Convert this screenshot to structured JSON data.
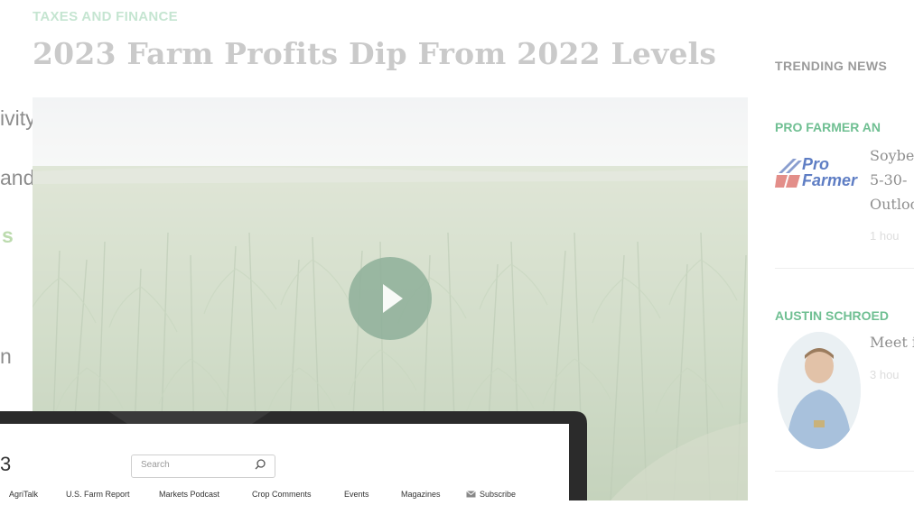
{
  "article": {
    "category": "TAXES AND FINANCE",
    "headline": "2023 Farm Profits Dip From 2022 Levels"
  },
  "background_text": {
    "line1": "ivity.",
    "line2": "and",
    "line3": "s",
    "line4": "n"
  },
  "video": {
    "play_icon": "play-icon"
  },
  "laptop": {
    "logo_fragment": "3",
    "search_placeholder": "Search",
    "nav": [
      "AgriTalk",
      "U.S. Farm Report",
      "Markets Podcast",
      "Crop Comments",
      "Events",
      "Magazines",
      "Subscribe"
    ]
  },
  "sidebar": {
    "title": "TRENDING NEWS",
    "items": [
      {
        "category": "PRO FARMER AN",
        "lines": [
          "Soybe",
          "5-30-",
          "Outloo"
        ],
        "time": "1 hou",
        "logo_line1": "Pro",
        "logo_line2": "Farmer"
      },
      {
        "category": "AUSTIN SCHROED",
        "lines": [
          "Meet i"
        ],
        "time": "3 hou"
      }
    ]
  },
  "colors": {
    "accent_green": "#7ec69a",
    "headline_gray": "#8a8a8a",
    "profarmer_blue": "#2a4fa8",
    "profarmer_red": "#d0433a"
  }
}
